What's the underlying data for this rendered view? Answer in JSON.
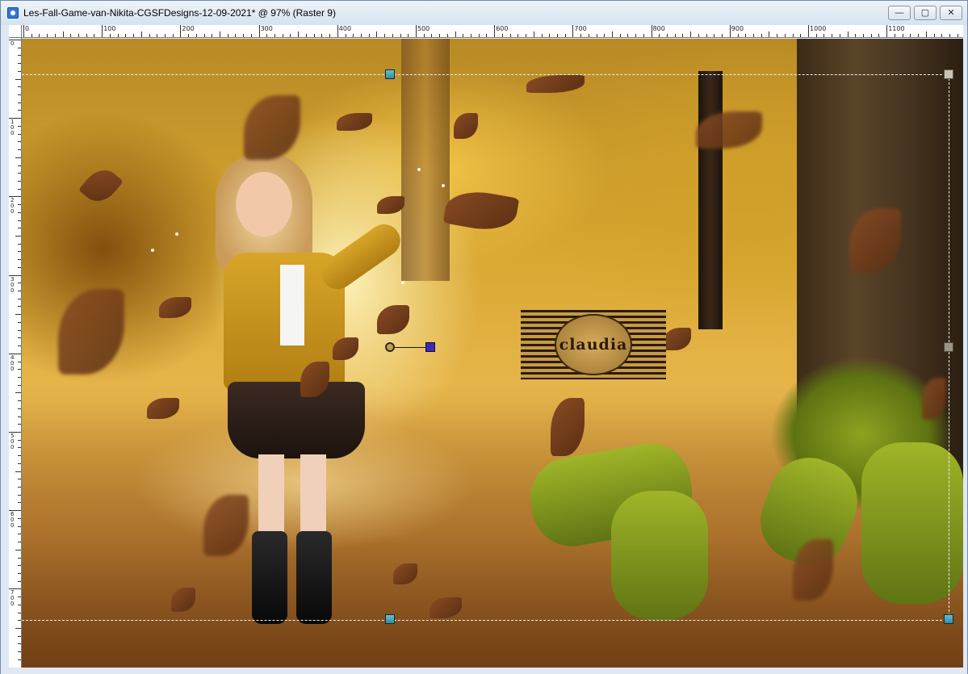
{
  "window": {
    "title": "Les-Fall-Game-van-Nikita-CGSFDesigns-12-09-2021* @  97% (Raster 9)",
    "controls": {
      "minimize_icon": "—",
      "maximize_icon": "▢",
      "close_icon": "✕"
    }
  },
  "ruler": {
    "horizontal": [
      "0",
      "100",
      "200",
      "300",
      "400",
      "500",
      "600",
      "700",
      "800",
      "900",
      "1000",
      "1100"
    ],
    "vertical": [
      "0",
      "100",
      "200",
      "300",
      "400",
      "500",
      "600",
      "700"
    ]
  },
  "canvas": {
    "layer": "Raster 9",
    "zoom": "97%",
    "watermark_text": "claudia"
  }
}
